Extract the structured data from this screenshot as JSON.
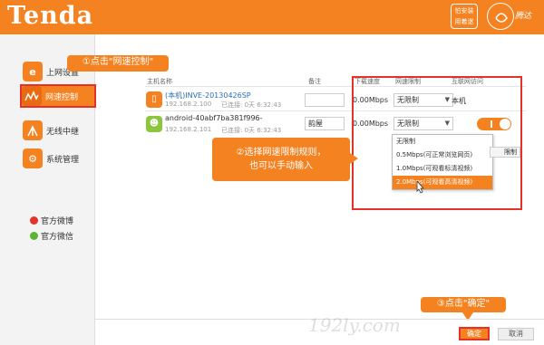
{
  "header": {
    "logo": "Tenda",
    "app_badge": "怕安装\n用着迷",
    "brand": "腾达"
  },
  "sidebar": {
    "items": [
      {
        "label": "上网设置",
        "icon": "globe-icon"
      },
      {
        "label": "网速控制",
        "icon": "speed-icon"
      },
      {
        "label": "无线中继",
        "icon": "wireless-icon"
      },
      {
        "label": "系统管理",
        "icon": "gear-icon"
      }
    ],
    "weibo": "官方微博",
    "weixin": "官方微信"
  },
  "table": {
    "headers": [
      "主机名称",
      "备注",
      "下载速度",
      "网速限制",
      "互联网访问"
    ],
    "rows": [
      {
        "name": "(本机)INVE-20130426SP",
        "ip": "192.168.2.100",
        "connected": "已连接: 0天 6:32:43",
        "note": "",
        "speed": "0.00Mbps",
        "limit": "无限制",
        "access": "本机"
      },
      {
        "name": "android-40abf7ba381f996-",
        "ip": "192.168.2.101",
        "connected": "已连接: 0天 6:32:43",
        "note": "韵屋",
        "speed": "0.00Mbps",
        "limit": "无限制",
        "access": ""
      }
    ]
  },
  "dropdown": {
    "options": [
      "无限制",
      "0.5Mbps(可正常浏览网页)",
      "1.0Mbps(可观看标清视频)",
      "2.0Mbps(可观看高清视频)"
    ],
    "selected_index": 3
  },
  "limit_button": "限制",
  "callouts": {
    "c1": "①点击\"网速控制\"",
    "c2_line1": "②选择网速限制规则，",
    "c2_line2": "也可以手动输入",
    "c3": "③点击\"确定\""
  },
  "footer": {
    "ok": "确定",
    "cancel": "取消"
  },
  "watermark": "192ly.com",
  "colors": {
    "brand_orange": "#f58220",
    "highlight_red": "#e4322b",
    "android_green": "#8cc63e"
  }
}
